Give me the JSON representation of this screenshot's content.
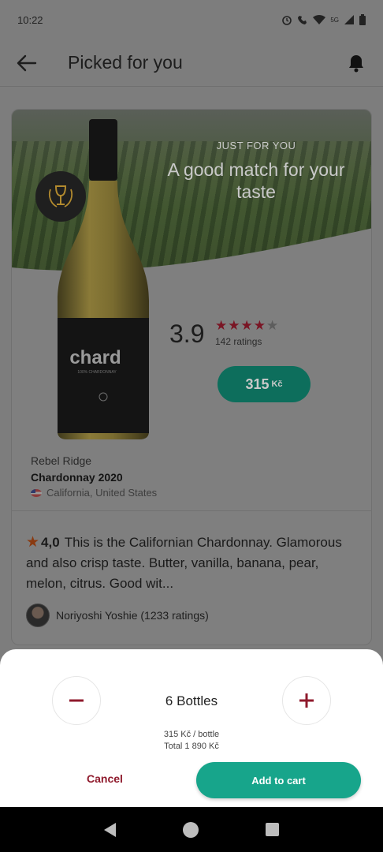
{
  "status_bar": {
    "time": "10:22",
    "network": "5G"
  },
  "app_bar": {
    "title": "Picked for you",
    "back_icon": "arrow-left-icon",
    "notification_icon": "bell-icon"
  },
  "hero": {
    "kicker": "JUST FOR YOU",
    "headline": "A good match for your taste"
  },
  "bottle": {
    "label_name": "chard",
    "label_sub": "100% CHARDONNAY"
  },
  "rating": {
    "value": "3.9",
    "stars_filled": 4,
    "stars_total": 5,
    "count": "142 ratings"
  },
  "price": {
    "amount": "315",
    "currency": "Kč"
  },
  "wine": {
    "winery": "Rebel Ridge",
    "name": "Chardonnay 2020",
    "region": "California, United States"
  },
  "review": {
    "score": "4,0",
    "text": "This is the Californian Chardonnay. Glamorous and also crisp taste. Butter, vanilla, banana, pear, melon, citrus. Good wit...",
    "author": "Noriyoshi Yoshie (1233 ratings)"
  },
  "sheet": {
    "quantity_label": "6 Bottles",
    "unit_price": "315 Kč / bottle",
    "total": "Total 1 890 Kč",
    "cancel_label": "Cancel",
    "add_label": "Add to cart"
  },
  "colors": {
    "accent_green": "#17a58b",
    "wine_red": "#8f1a2c",
    "star_red": "#7a1524"
  }
}
